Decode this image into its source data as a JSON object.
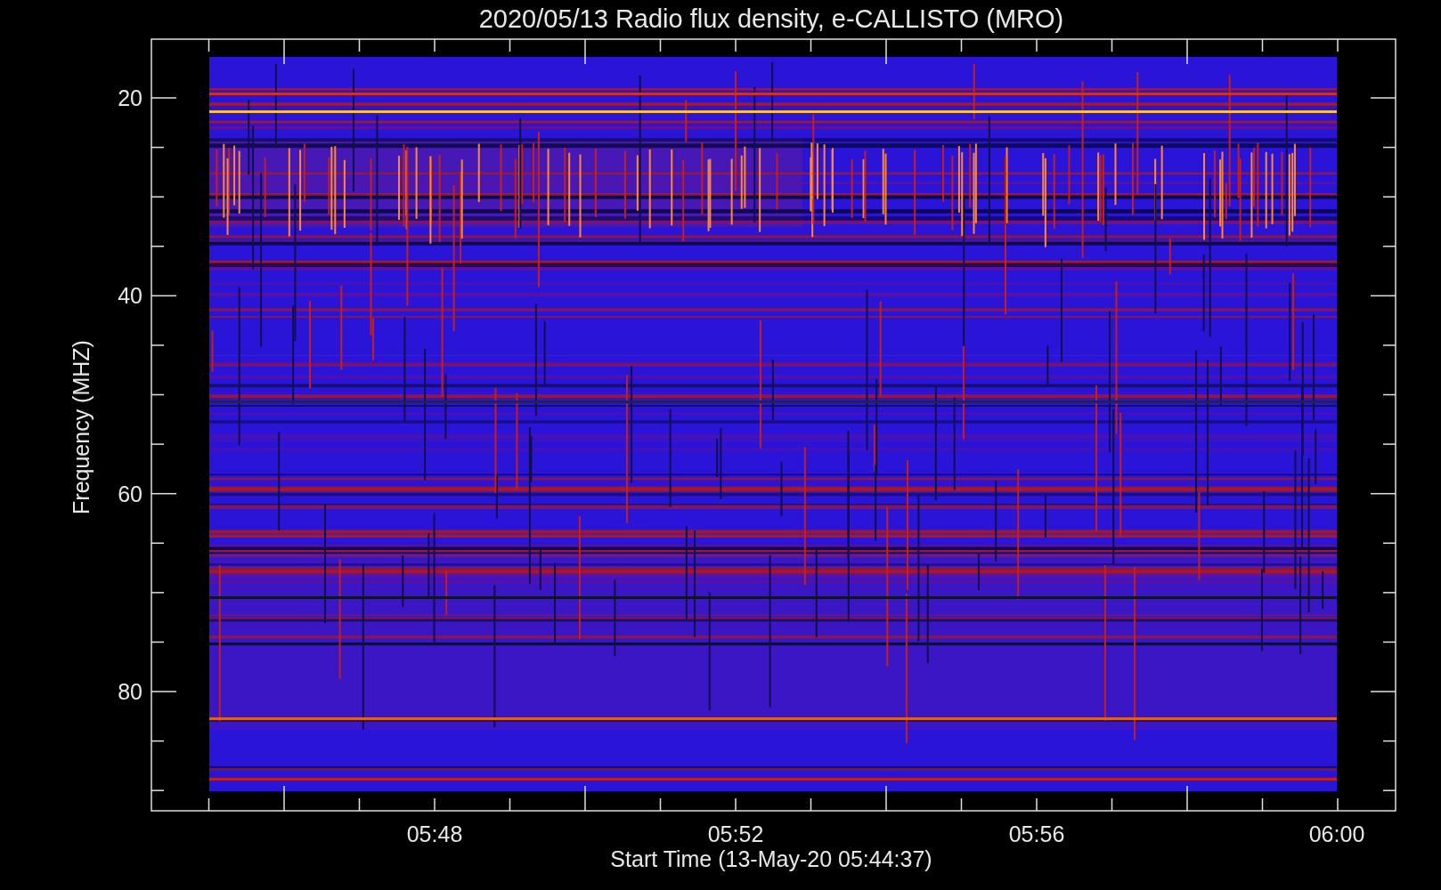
{
  "title": "2020/05/13  Radio flux density, e-CALLISTO (MRO)",
  "y_axis": {
    "label": "Frequency (MHZ)",
    "ticks": [
      "20",
      "40",
      "60",
      "80"
    ]
  },
  "x_axis": {
    "label": "Start Time (13-May-20 05:44:37)",
    "ticks": [
      "05:48",
      "05:52",
      "05:56",
      "06:00"
    ]
  }
}
